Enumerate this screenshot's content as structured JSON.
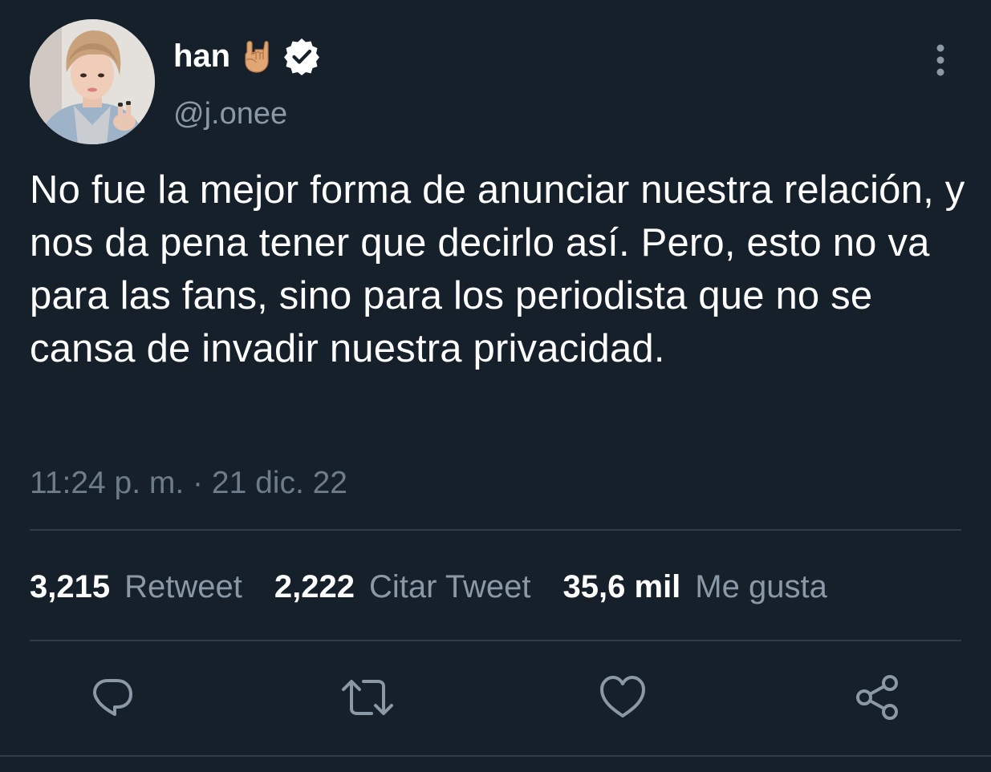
{
  "author": {
    "display_name": "han",
    "handle": "@j.onee",
    "verified": true,
    "emoji": "🤘"
  },
  "tweet": {
    "text": "No fue la mejor forma de anunciar nuestra relación, y nos da pena tener que decirlo así. Pero, esto no va para las fans, sino para los periodista que no se cansa de invadir nuestra privacidad.",
    "timestamp": "11:24 p. m. · 21 dic. 22"
  },
  "stats": {
    "retweets_count": "3,215",
    "retweets_label": "Retweet",
    "quotes_count": "2,222",
    "quotes_label": "Citar Tweet",
    "likes_count": "35,6 mil",
    "likes_label": "Me gusta"
  },
  "actions": [
    "reply-icon",
    "retweet-icon",
    "like-icon",
    "share-icon"
  ],
  "colors": {
    "background": "#15202b",
    "text": "#ffffff",
    "secondary_text": "#8b98a5",
    "icon": "#8b98a5",
    "divider": "#2f3b47"
  }
}
